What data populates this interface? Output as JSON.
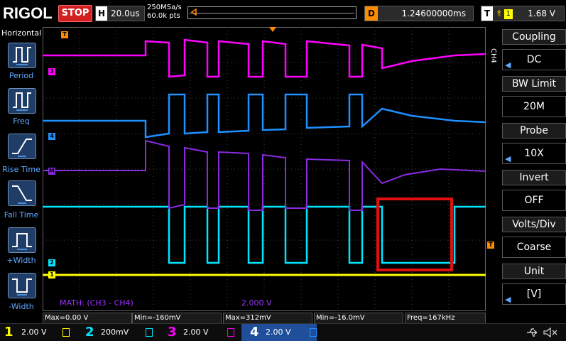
{
  "top": {
    "brand": "RIGOL",
    "run_status": "STOP",
    "horizontal_label": "H",
    "timebase": "20.0us",
    "sample_rate": "250MSa/s",
    "memory_depth": "60.0k pts",
    "delay_label": "D",
    "delay_value": "1.24600000ms",
    "trigger_label": "T",
    "trigger_channel": "1",
    "trigger_level": "1.68 V"
  },
  "left_menu": {
    "title": "Horizontal",
    "items": [
      {
        "label": "Period",
        "icon": "period-icon"
      },
      {
        "label": "Freq",
        "icon": "freq-icon"
      },
      {
        "label": "Rise Time",
        "icon": "rise-time-icon"
      },
      {
        "label": "Fall Time",
        "icon": "fall-time-icon"
      },
      {
        "label": "+Width",
        "icon": "pos-width-icon"
      },
      {
        "label": "-Width",
        "icon": "neg-width-icon"
      }
    ]
  },
  "right_menu": {
    "channel_tag": "CH4",
    "items": [
      {
        "header": "Coupling",
        "value": "DC"
      },
      {
        "header": "BW Limit",
        "value": "20M"
      },
      {
        "header": "Probe",
        "value": "10X"
      },
      {
        "header": "Invert",
        "value": "OFF"
      },
      {
        "header": "Volts/Div",
        "value": "Coarse"
      },
      {
        "header": "Unit",
        "value": "[V]"
      }
    ]
  },
  "scope": {
    "math_label": "MATH: (CH3 - CH4)",
    "math_scale": "2.000 V",
    "markers": {
      "ch1": "1",
      "ch2": "2",
      "ch3": "3",
      "ch4": "4",
      "math": "M",
      "trigger": "T"
    },
    "colors": {
      "ch1": "#ffff00",
      "ch2": "#00e5ff",
      "ch3": "#ff00ff",
      "ch4": "#1e90ff",
      "math": "#8a2be2",
      "trigger": "#ff8c00",
      "highlight": "#e01010"
    }
  },
  "measurements": [
    {
      "text": "Max=0.00 V"
    },
    {
      "text": "Min=-160mV"
    },
    {
      "text": "Max=312mV"
    },
    {
      "text": "Min=-16.0mV"
    },
    {
      "text": "Freq=167kHz"
    }
  ],
  "channels": [
    {
      "num": "1",
      "scale": "2.00 V",
      "color": "#ffff00"
    },
    {
      "num": "2",
      "scale": "200mV",
      "color": "#00e5ff"
    },
    {
      "num": "3",
      "scale": "2.00 V",
      "color": "#ff00ff"
    },
    {
      "num": "4",
      "scale": "2.00 V",
      "color": "#1e90ff"
    }
  ]
}
